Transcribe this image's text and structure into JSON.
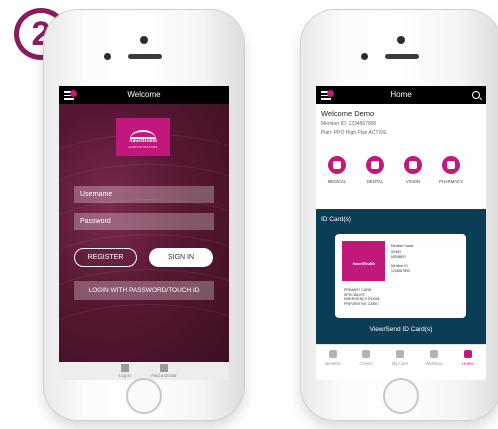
{
  "step_badge": "2",
  "left_phone": {
    "nav_title": "Welcome",
    "logo_text": "AmeriHealth",
    "logo_subtext": "ADMINISTRATORS",
    "username_placeholder": "Username",
    "password_placeholder": "Password",
    "register_label": "REGISTER",
    "sign_in_label": "SIGN IN",
    "touch_id_label": "LOGIN WITH PASSWORD/TOUCH ID",
    "tabs": [
      {
        "label": "Log In",
        "icon": "login-icon"
      },
      {
        "label": "Find a Doctor",
        "icon": "doctor-icon"
      }
    ]
  },
  "right_phone": {
    "nav_title": "Home",
    "welcome": "Welcome Demo",
    "member_id": "Member ID: 1234567890",
    "plan": "Plan: PPO High Plan ACTIVE",
    "categories": [
      {
        "label": "MEDICAL",
        "icon": "medical-icon"
      },
      {
        "label": "DENTAL",
        "icon": "tooth-icon"
      },
      {
        "label": "VISION",
        "icon": "eye-icon"
      },
      {
        "label": "PHARMACY",
        "icon": "pill-icon"
      }
    ],
    "id_cards_title": "ID Card(s)",
    "card": {
      "logo_text": "AmeriHealth",
      "member_name_label": "Member Name",
      "member_name": "DEMO",
      "member_name_2": "MEMBER",
      "member_id_label": "Member ID",
      "member_id": "1234567890",
      "lines": [
        "PRIMARY CARE:",
        "SPECIALIST:",
        "EMERGENCY ROOM:",
        "PREVENTIVE CARE:"
      ]
    },
    "view_send": "View/Send ID Card(s)",
    "tabs": [
      {
        "label": "Benefits",
        "icon": "plus-icon"
      },
      {
        "label": "Claims",
        "icon": "dollar-icon"
      },
      {
        "label": "My Care",
        "icon": "heart-icon"
      },
      {
        "label": "Wellness",
        "icon": "apple-icon"
      },
      {
        "label": "Home",
        "icon": "home-icon",
        "active": true
      }
    ]
  },
  "colors": {
    "brand_magenta": "#c2187e",
    "teal": "#0b3d57",
    "login_bg": "#571734"
  }
}
